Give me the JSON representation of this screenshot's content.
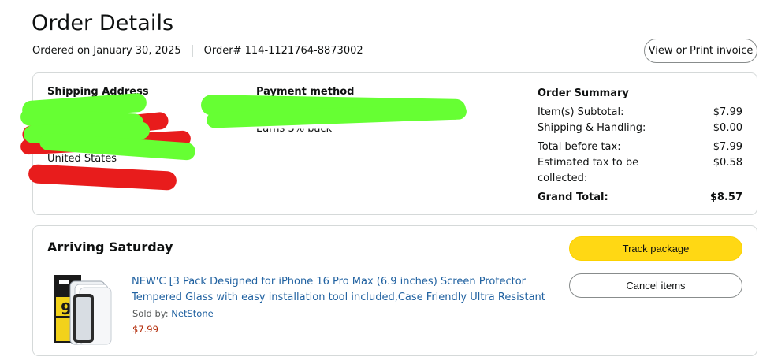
{
  "page": {
    "title": "Order Details",
    "ordered_on": "Ordered on January 30, 2025",
    "order_number": "Order# 114-1121764-8873002",
    "invoice_button": "View or Print invoice"
  },
  "shipping": {
    "heading": "Shipping Address",
    "country": "United States"
  },
  "payment": {
    "heading": "Payment method",
    "visible_fragment": "Earns 5% back"
  },
  "summary": {
    "heading": "Order Summary",
    "rows": [
      {
        "label": "Item(s) Subtotal:",
        "value": "$7.99"
      },
      {
        "label": "Shipping & Handling:",
        "value": "$0.00"
      },
      {
        "label": "Total before tax:",
        "value": "$7.99"
      },
      {
        "label": "Estimated tax to be collected:",
        "value": "$0.58"
      }
    ],
    "grand_total_label": "Grand Total:",
    "grand_total_value": "$8.57"
  },
  "shipment": {
    "status": "Arriving Saturday",
    "track_button": "Track package",
    "cancel_button": "Cancel items",
    "item": {
      "title": "NEW'C [3 Pack Designed for iPhone 16 Pro Max (6.9 inches) Screen Protector Tempered Glass with easy installation tool included,Case Friendly Ultra Resistant",
      "sold_by_label": "Sold by:",
      "seller": "NetStone",
      "price": "$7.99",
      "thumbnail_icon": "screen-protector-product-image"
    }
  },
  "colors": {
    "link": "#2162a1",
    "price": "#b12704",
    "track_button_bg": "#ffd814",
    "redaction_green": "#66ff33",
    "redaction_red": "#e81c1c"
  }
}
